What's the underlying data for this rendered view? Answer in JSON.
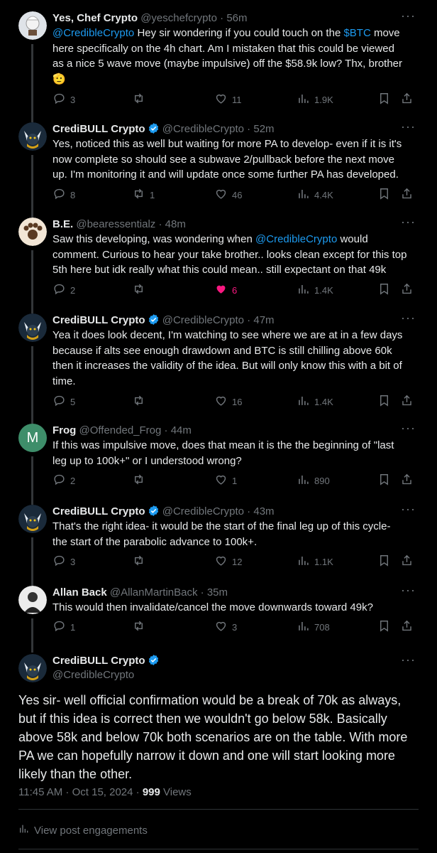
{
  "tweets": [
    {
      "name": "Yes, Chef Crypto",
      "handle": "@yeschefcrypto",
      "time": "56m",
      "verified": false,
      "segments": [
        {
          "t": "@CredibleCrypto",
          "link": true
        },
        {
          "t": " Hey sir wondering if you could touch on the ",
          "link": false
        },
        {
          "t": "$BTC",
          "link": true
        },
        {
          "t": " move here specifically on the 4h chart. Am I mistaken that this could be viewed as a nice 5 wave move (maybe impulsive) off the $58.9k low? Thx, brother",
          "link": false
        },
        {
          "t": "🫡",
          "link": false
        }
      ],
      "replies": "3",
      "reposts": "",
      "likes": "11",
      "views": "1.9K",
      "liked": false
    },
    {
      "name": "CrediBULL Crypto",
      "handle": "@CredibleCrypto",
      "time": "52m",
      "verified": true,
      "segments": [
        {
          "t": "Yes, noticed this as well but waiting for more PA to develop- even if it is it's now complete so should see a subwave 2/pullback before the next move up. I'm monitoring it and will update once some further PA has developed.",
          "link": false
        }
      ],
      "replies": "8",
      "reposts": "1",
      "likes": "46",
      "views": "4.4K",
      "liked": false
    },
    {
      "name": "B.E.",
      "handle": "@bearessentialz",
      "time": "48m",
      "verified": false,
      "segments": [
        {
          "t": "Saw this developing, was wondering when ",
          "link": false
        },
        {
          "t": "@CredibleCrypto",
          "link": true
        },
        {
          "t": " would comment. Curious to hear your take brother.. looks clean except for this top 5th here but idk really what this could mean.. still expectant on that 49k",
          "link": false
        }
      ],
      "replies": "2",
      "reposts": "",
      "likes": "6",
      "views": "1.4K",
      "liked": true
    },
    {
      "name": "CrediBULL Crypto",
      "handle": "@CredibleCrypto",
      "time": "47m",
      "verified": true,
      "segments": [
        {
          "t": "Yea it does look decent, I'm watching to see where we are at in a few days because if alts see enough drawdown and BTC is still chilling above 60k then it increases the validity of the idea. But will only know this with a bit of time.",
          "link": false
        }
      ],
      "replies": "5",
      "reposts": "",
      "likes": "16",
      "views": "1.4K",
      "liked": false
    },
    {
      "name": "Frog",
      "handle": "@Offended_Frog",
      "time": "44m",
      "verified": false,
      "initial": "M",
      "segments": [
        {
          "t": "If this was impulsive move, does that mean it is the the beginning of \"last leg up to 100k+\" or I understood wrong?",
          "link": false
        }
      ],
      "replies": "2",
      "reposts": "",
      "likes": "1",
      "views": "890",
      "liked": false
    },
    {
      "name": "CrediBULL Crypto",
      "handle": "@CredibleCrypto",
      "time": "43m",
      "verified": true,
      "segments": [
        {
          "t": "That's the right idea- it would be the start of the final leg up of this cycle- the start of the parabolic advance to 100k+.",
          "link": false
        }
      ],
      "replies": "3",
      "reposts": "",
      "likes": "12",
      "views": "1.1K",
      "liked": false
    },
    {
      "name": "Allan Back",
      "handle": "@AllanMartinBack",
      "time": "35m",
      "verified": false,
      "segments": [
        {
          "t": "This would then invalidate/cancel the move downwards toward 49k?",
          "link": false
        }
      ],
      "replies": "1",
      "reposts": "",
      "likes": "3",
      "views": "708",
      "liked": false
    }
  ],
  "main": {
    "name": "CrediBULL Crypto",
    "handle": "@CredibleCrypto",
    "text": "Yes sir- well official confirmation would be a break of 70k as always, but if this idea is correct then we wouldn't go below 58k. Basically above 58k and below 70k both scenarios are on the table. With more PA we can hopefully narrow it down and one will start looking more likely than the other.",
    "timestamp": "11:45 AM · Oct 15, 2024 · ",
    "views_count": "999",
    "views_label": " Views",
    "engagements": "View post engagements"
  },
  "separator": " · ",
  "icons": [
    "more-icon",
    "reply-icon",
    "repost-icon",
    "like-icon",
    "views-icon",
    "bookmark-icon",
    "share-icon",
    "verified-icon"
  ],
  "colors": {
    "background": "#000000",
    "text": "#e7e9ea",
    "muted": "#71767b",
    "link": "#1d9bf0",
    "verified": "#1d9bf0",
    "liked": "#f91880"
  }
}
